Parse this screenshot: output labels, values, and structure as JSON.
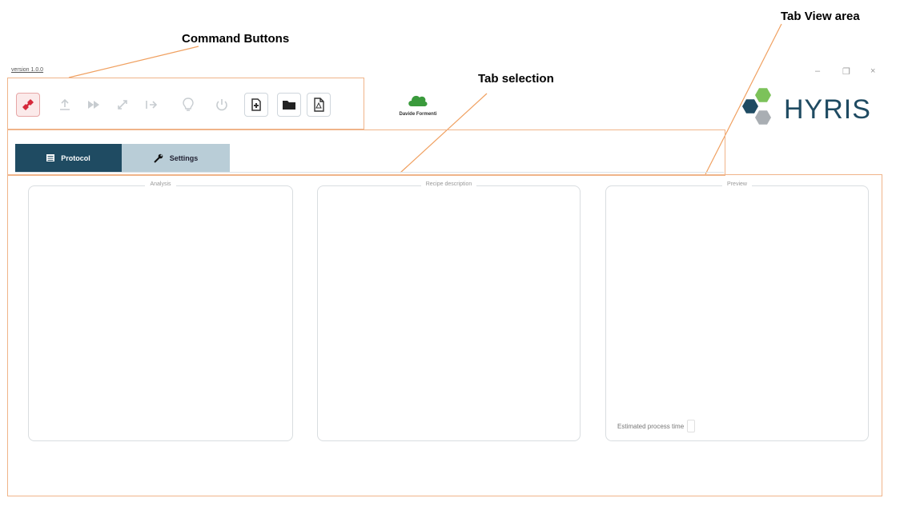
{
  "annotations": {
    "command_buttons": "Command Buttons",
    "tab_selection": "Tab selection",
    "tab_view_area": "Tab View area"
  },
  "window": {
    "version": "version 1.0.0",
    "controls": {
      "minimize": "–",
      "maximize": "❐",
      "close": "×"
    }
  },
  "toolbar": {
    "buttons": [
      {
        "name": "disconnect",
        "icon": "plug-disconnect-icon",
        "enabled": true
      },
      {
        "name": "upload",
        "icon": "upload-icon",
        "enabled": false
      },
      {
        "name": "fast-forward",
        "icon": "fast-forward-icon",
        "enabled": false
      },
      {
        "name": "expand",
        "icon": "expand-icon",
        "enabled": false
      },
      {
        "name": "export",
        "icon": "export-icon",
        "enabled": false
      },
      {
        "name": "lightbulb",
        "icon": "lightbulb-icon",
        "enabled": false
      },
      {
        "name": "power",
        "icon": "power-icon",
        "enabled": false
      },
      {
        "name": "new-file",
        "icon": "new-file-icon",
        "enabled": true
      },
      {
        "name": "open-folder",
        "icon": "folder-icon",
        "enabled": true
      },
      {
        "name": "pdf",
        "icon": "pdf-icon",
        "enabled": true
      }
    ]
  },
  "brand": {
    "partner_logo_text": "Davide Formenti",
    "logo_text": "HYRIS"
  },
  "tabs": [
    {
      "label": "Protocol",
      "icon": "list-icon",
      "active": true
    },
    {
      "label": "Settings",
      "icon": "wrench-icon",
      "active": false
    }
  ],
  "panels": {
    "analysis": "Analysis",
    "recipe_description": "Recipe description",
    "preview": "Preview",
    "estimated_time_label": "Estimated process time"
  },
  "colors": {
    "accent": "#1f4b62",
    "tab_inactive": "#b9cdd7",
    "annotation_lines": "#f0b489",
    "disconnect": "#d62a3c",
    "cloud": "#3a9a3c"
  }
}
